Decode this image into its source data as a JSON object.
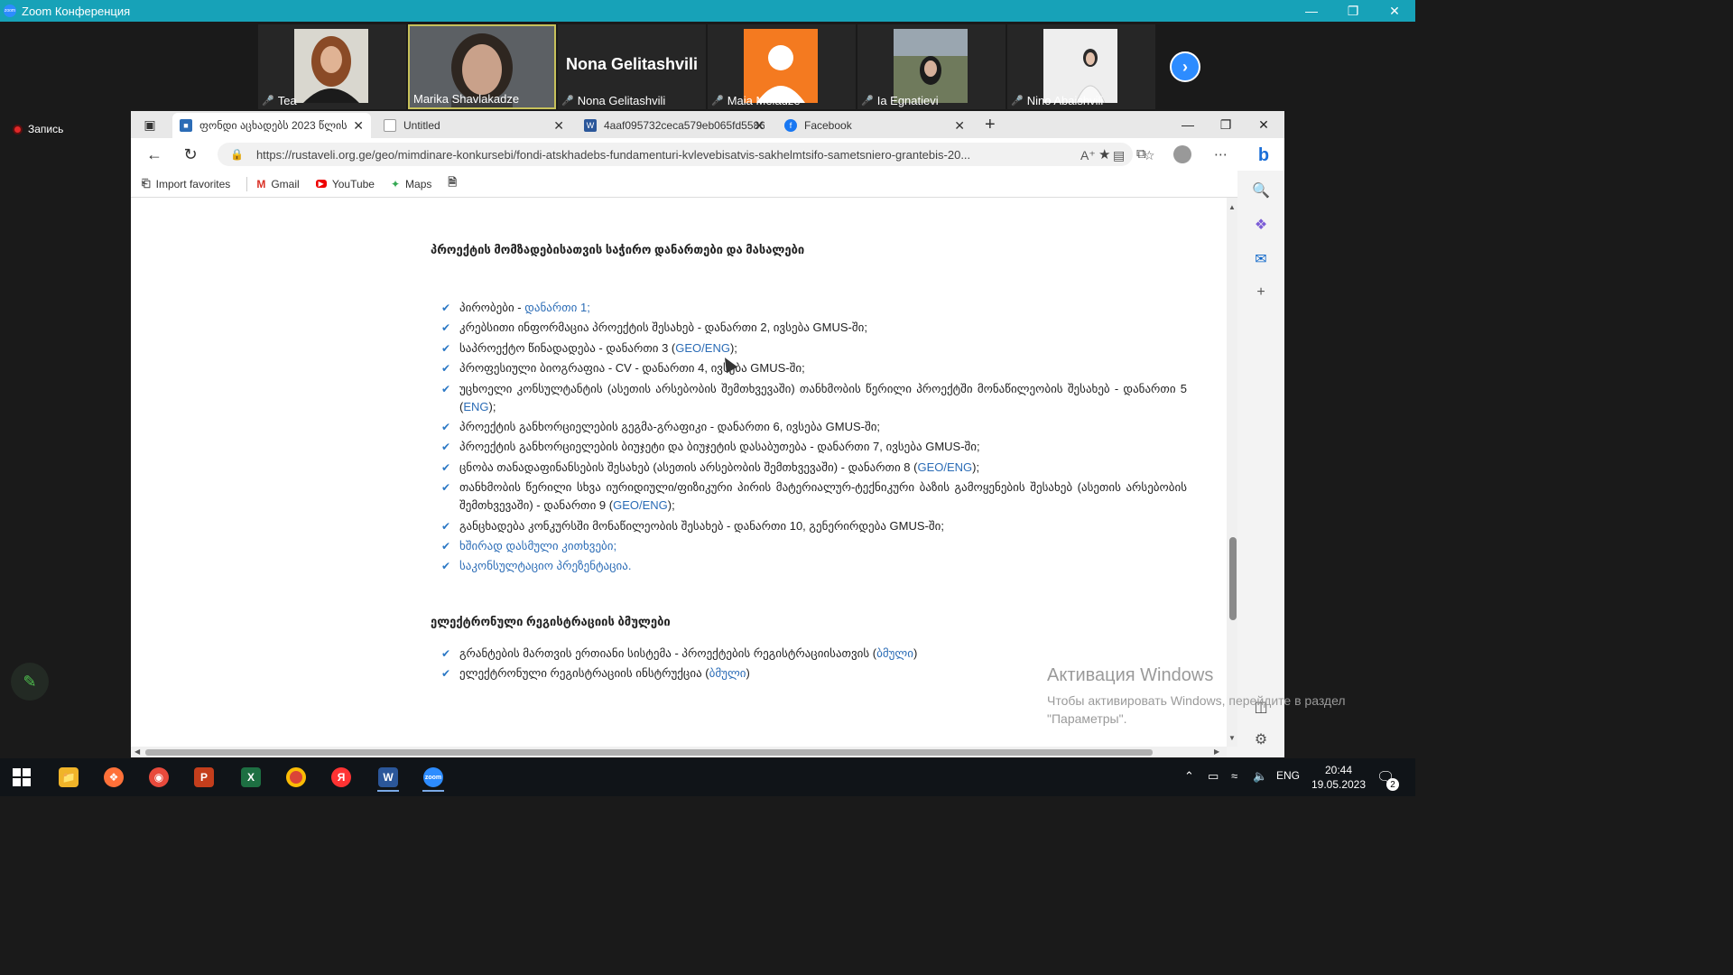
{
  "zoom": {
    "title": "Zoom Конференция",
    "logo_text": "zoom",
    "record_label": "Запись",
    "participants": [
      {
        "name": "Tea",
        "muted": true
      },
      {
        "name": "Marika Shavlakadze",
        "muted": false,
        "active": true
      },
      {
        "name": "Nona Gelitashvili",
        "muted": true,
        "big_name": "Nona Gelitashvili"
      },
      {
        "name": "Maia Meladze",
        "muted": true
      },
      {
        "name": "Ia Egnatievi",
        "muted": true
      },
      {
        "name": "Nino Abaishvili",
        "muted": true
      }
    ]
  },
  "browser": {
    "tabs": [
      {
        "title": "ფონდი აცხადებს 2023 წლის",
        "active": true
      },
      {
        "title": "Untitled",
        "active": false
      },
      {
        "title": "4aaf095732ceca579eb065fd5586",
        "active": false
      },
      {
        "title": "Facebook",
        "active": false
      }
    ],
    "url": "https://rustaveli.org.ge/geo/mimdinare-konkursebi/fondi-atskhadebs-fundamenturi-kvlevebisatvis-sakhelmtsifo-sametsniero-grantebis-20...",
    "favorites": [
      {
        "label": "Import favorites",
        "icon": "import-icon"
      },
      {
        "label": "Gmail",
        "icon": "gmail-icon"
      },
      {
        "label": "YouTube",
        "icon": "youtube-icon"
      },
      {
        "label": "Maps",
        "icon": "maps-icon"
      }
    ]
  },
  "content": {
    "section1_title": "პროექტის მომზადებისათვის საჭირო დანართები და მასალები",
    "section1_items": [
      {
        "text": "პირობები - ",
        "link": "დანართი 1;",
        "after": ""
      },
      {
        "text": "კრებსითი ინფორმაცია პროექტის შესახებ - დანართი 2, ივსება GMUS-ში;",
        "link": "",
        "after": ""
      },
      {
        "text": "საპროექტო წინადადება - დანართი 3 (",
        "link": "GEO/ENG",
        "after": ");"
      },
      {
        "text": "პროფესიული ბიოგრაფია - CV - დანართი 4, ივსება GMUS-ში;",
        "link": "",
        "after": ""
      },
      {
        "text": "უცხოელი კონსულტანტის (ასეთის არსებობის შემთხვევაში) თანხმობის წერილი პროექტში მონაწილეობის შესახებ - დანართი 5 (",
        "link": "ENG",
        "after": ");"
      },
      {
        "text": "პროექტის განხორციელების გეგმა-გრაფიკი -  დანართი 6, ივსება GMUS-ში;",
        "link": "",
        "after": ""
      },
      {
        "text": "პროექტის განხორციელების ბიუჯეტი და ბიუჯეტის დასაბუთება - დანართი 7, ივსება GMUS-ში;",
        "link": "",
        "after": ""
      },
      {
        "text": "ცნობა თანადაფინანსების შესახებ (ასეთის არსებობის შემთხვევაში) - დანართი 8 (",
        "link": "GEO/ENG",
        "after": ");"
      },
      {
        "text": "თანხმობის წერილი სხვა იურიდიული/ფიზიკური პირის მატერიალურ-ტექნიკური ბაზის გამოყენების შესახებ (ასეთის არსებობის შემთხვევაში) - დანართი 9 (",
        "link": "GEO/ENG",
        "after": ");"
      },
      {
        "text": "განცხადება კონკურსში მონაწილეობის შესახებ - დანართი 10, გენერირდება GMUS-ში;",
        "link": "",
        "after": ""
      },
      {
        "text": "",
        "link": "ხშირად დასმული კითხვები;",
        "after": ""
      },
      {
        "text": "",
        "link": "საკონსულტაციო პრეზენტაცია.",
        "after": ""
      }
    ],
    "section2_title": "ელექტრონული რეგისტრაციის ბმულები",
    "section2_items": [
      {
        "text": "გრანტების მართვის ერთიანი სისტემა - პროექტების რეგისტრაციისათვის (",
        "link": "ბმული",
        "after": ")"
      },
      {
        "text": "ელექტრონული რეგისტრაციის ინსტრუქცია (",
        "link": "ბმული",
        "after": ")"
      }
    ]
  },
  "activation": {
    "title": "Активация Windows",
    "line1": "Чтобы активировать Windows, перейдите в раздел",
    "line2": "\"Параметры\"."
  },
  "taskbar": {
    "lang": "ENG",
    "time": "20:44",
    "date": "19.05.2023",
    "notifications": "2"
  },
  "colors": {
    "zoom_titlebar": "#17a2b8",
    "link": "#2b6cb6",
    "check": "#2b78c5",
    "zoom_blue": "#2d8cff"
  }
}
